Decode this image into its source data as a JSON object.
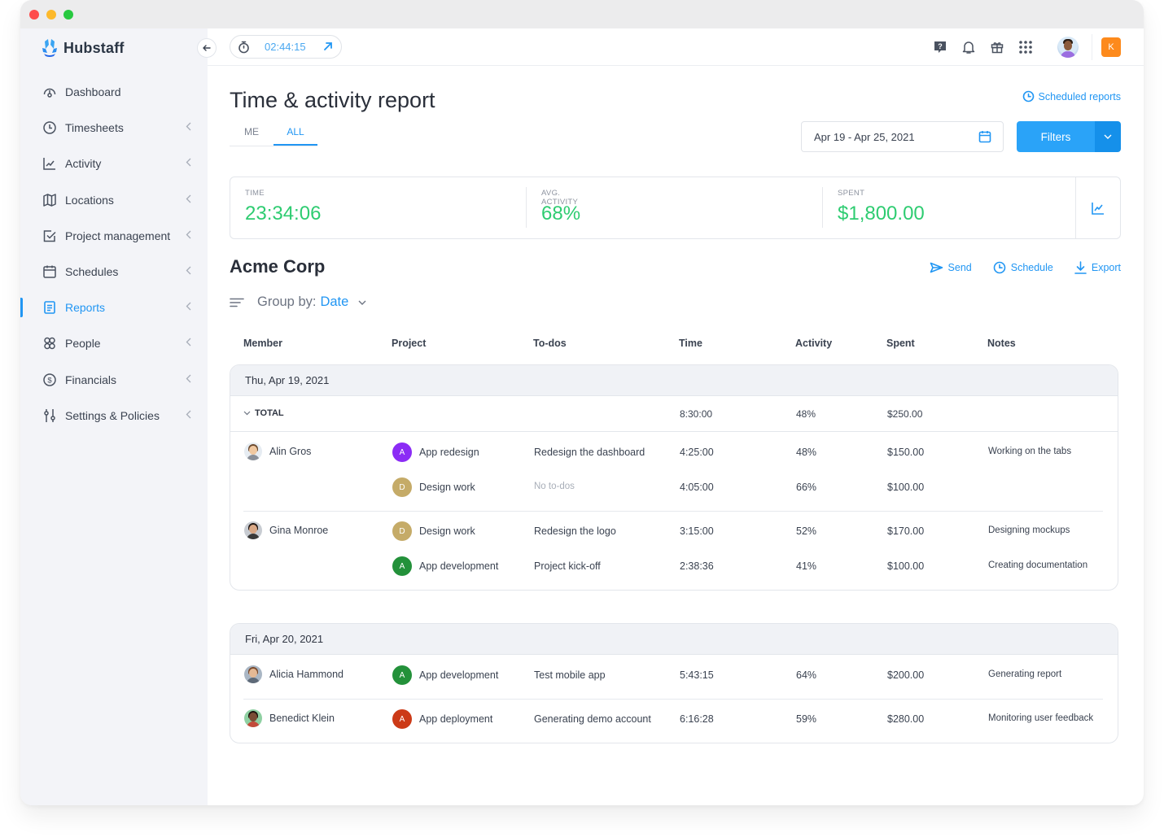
{
  "window": {
    "controls": [
      "close",
      "minimize",
      "maximize"
    ]
  },
  "brand": {
    "name": "Hubstaff"
  },
  "sidebar": {
    "items": [
      {
        "label": "Dashboard",
        "icon": "dashboard-icon",
        "expandable": false,
        "active": false
      },
      {
        "label": "Timesheets",
        "icon": "clock-icon",
        "expandable": true,
        "active": false
      },
      {
        "label": "Activity",
        "icon": "activity-chart-icon",
        "expandable": true,
        "active": false
      },
      {
        "label": "Locations",
        "icon": "map-icon",
        "expandable": true,
        "active": false
      },
      {
        "label": "Project management",
        "icon": "checkbox-icon",
        "expandable": true,
        "active": false
      },
      {
        "label": "Schedules",
        "icon": "calendar-icon",
        "expandable": true,
        "active": false
      },
      {
        "label": "Reports",
        "icon": "report-icon",
        "expandable": true,
        "active": true
      },
      {
        "label": "People",
        "icon": "people-icon",
        "expandable": true,
        "active": false
      },
      {
        "label": "Financials",
        "icon": "dollar-icon",
        "expandable": true,
        "active": false
      },
      {
        "label": "Settings & Policies",
        "icon": "sliders-icon",
        "expandable": true,
        "active": false
      }
    ]
  },
  "topbar": {
    "timer": "02:44:15",
    "icons": [
      "help-icon",
      "bell-icon",
      "gift-icon",
      "apps-grid-icon"
    ],
    "org_initial": "K",
    "org_color": "#fd8a1c"
  },
  "page": {
    "title": "Time & activity report",
    "scheduled_reports": "Scheduled reports",
    "tabs": [
      {
        "label": "ME",
        "active": false
      },
      {
        "label": "ALL",
        "active": true
      }
    ],
    "date_range": "Apr 19 - Apr 25, 2021",
    "filters_label": "Filters"
  },
  "summary": {
    "time_label": "TIME",
    "time_value": "23:34:06",
    "activity_label": "AVG. ACTIVITY",
    "activity_value": "68%",
    "spent_label": "SPENT",
    "spent_value": "$1,800.00",
    "accent": "#2ecc71"
  },
  "report": {
    "org": "Acme Corp",
    "actions": {
      "send": "Send",
      "schedule": "Schedule",
      "export": "Export"
    },
    "group_by_label": "Group by:",
    "group_by_value": "Date",
    "columns": [
      "Member",
      "Project",
      "To-dos",
      "Time",
      "Activity",
      "Spent",
      "Notes"
    ],
    "groups": [
      {
        "date": "Thu, Apr 19, 2021",
        "total": {
          "label": "TOTAL",
          "time": "8:30:00",
          "activity": "48%",
          "spent": "$250.00"
        },
        "members": [
          {
            "name": "Alin Gros",
            "rows": [
              {
                "project": "App redesign",
                "initial": "A",
                "color": "#8b2cf5",
                "todo": "Redesign the dashboard",
                "time": "4:25:00",
                "activity": "48%",
                "spent": "$150.00",
                "notes": "Working on the tabs"
              },
              {
                "project": "Design work",
                "initial": "D",
                "color": "#c5ab68",
                "todo": "No to-dos",
                "todo_muted": true,
                "time": "4:05:00",
                "activity": "66%",
                "spent": "$100.00",
                "notes": ""
              }
            ]
          },
          {
            "name": "Gina Monroe",
            "rows": [
              {
                "project": "Design work",
                "initial": "D",
                "color": "#c5ab68",
                "todo": "Redesign the logo",
                "time": "3:15:00",
                "activity": "52%",
                "spent": "$170.00",
                "notes": "Designing mockups"
              },
              {
                "project": "App development",
                "initial": "A",
                "color": "#23913a",
                "todo": "Project kick-off",
                "time": "2:38:36",
                "activity": "41%",
                "spent": "$100.00",
                "notes": "Creating documentation"
              }
            ]
          }
        ]
      },
      {
        "date": "Fri, Apr 20, 2021",
        "members": [
          {
            "name": "Alicia Hammond",
            "rows": [
              {
                "project": "App development",
                "initial": "A",
                "color": "#23913a",
                "todo": "Test mobile app",
                "time": "5:43:15",
                "activity": "64%",
                "spent": "$200.00",
                "notes": "Generating report"
              }
            ]
          },
          {
            "name": "Benedict Klein",
            "rows": [
              {
                "project": "App deployment",
                "initial": "A",
                "color": "#cc3a17",
                "todo": "Generating demo account",
                "time": "6:16:28",
                "activity": "59%",
                "spent": "$280.00",
                "notes": "Monitoring user feedback"
              }
            ]
          }
        ]
      }
    ]
  }
}
